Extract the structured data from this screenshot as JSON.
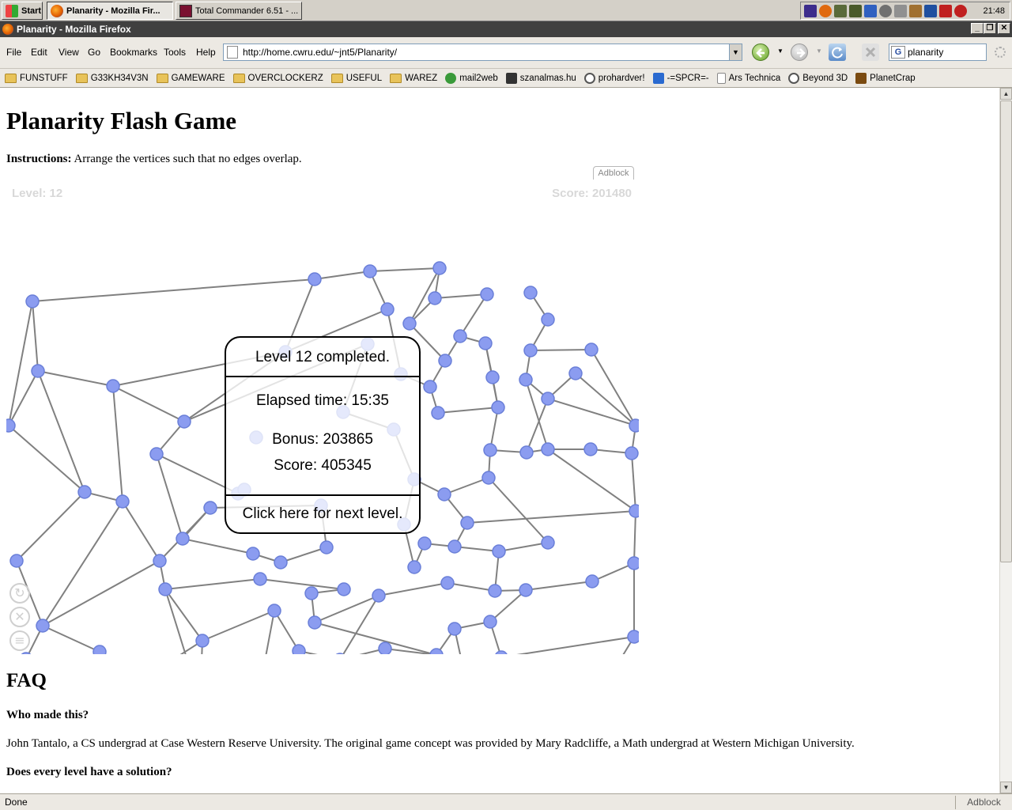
{
  "taskbar": {
    "start_label": "Start",
    "buttons": [
      {
        "label": "Planarity - Mozilla Fir...",
        "active": true
      },
      {
        "label": "Total Commander 6.51 - ...",
        "active": false
      }
    ],
    "clock": "21:48"
  },
  "window": {
    "title": "Planarity - Mozilla Firefox"
  },
  "menu": [
    "File",
    "Edit",
    "View",
    "Go",
    "Bookmarks",
    "Tools",
    "Help"
  ],
  "url": "http://home.cwru.edu/~jnt5/Planarity/",
  "search": {
    "value": "planarity",
    "engine_icon": "G"
  },
  "bookmarks": [
    {
      "label": "FUNSTUFF",
      "type": "folder"
    },
    {
      "label": "G33KH34V3N",
      "type": "folder"
    },
    {
      "label": "GAMEWARE",
      "type": "folder"
    },
    {
      "label": "OVERCLOCKERZ",
      "type": "folder"
    },
    {
      "label": "USEFUL",
      "type": "folder"
    },
    {
      "label": "WAREZ",
      "type": "folder"
    },
    {
      "label": "mail2web",
      "type": "link"
    },
    {
      "label": "szanalmas.hu",
      "type": "link"
    },
    {
      "label": "prohardver!",
      "type": "link"
    },
    {
      "label": "-=SPCR=-",
      "type": "link"
    },
    {
      "label": "Ars Technica",
      "type": "link"
    },
    {
      "label": "Beyond 3D",
      "type": "link"
    },
    {
      "label": "PlanetCrap",
      "type": "link"
    }
  ],
  "page": {
    "title": "Planarity Flash Game",
    "instructions_label": "Instructions:",
    "instructions_text": " Arrange the vertices such that no edges overlap.",
    "adblock_tab": "Adblock",
    "game": {
      "level_text": "Level: 12",
      "score_text": "Score: 201480",
      "dialog": {
        "completed": "Level 12 completed.",
        "elapsed": "Elapsed time: 15:35",
        "bonus": "Bonus: 203865",
        "score": "Score: 405345",
        "next": "Click here for next level."
      },
      "controls": [
        "refresh-icon",
        "close-icon",
        "list-icon"
      ]
    },
    "faq_heading": "FAQ",
    "faq": [
      {
        "q": "Who made this?",
        "a": "John Tantalo, a CS undergrad at Case Western Reserve University. The original game concept was provided by Mary Radcliffe, a Math undergrad at Western Michigan University."
      },
      {
        "q": "Does every level have a solution?",
        "a": ""
      }
    ]
  },
  "status": {
    "text": "Done",
    "adblock": "Adblock"
  },
  "colors": {
    "vertex": "#8b9cf0",
    "vertex_stroke": "#6a7fd8",
    "edge": "#808080",
    "taskbar": "#d4d0c8",
    "titlebar": "#404040"
  }
}
